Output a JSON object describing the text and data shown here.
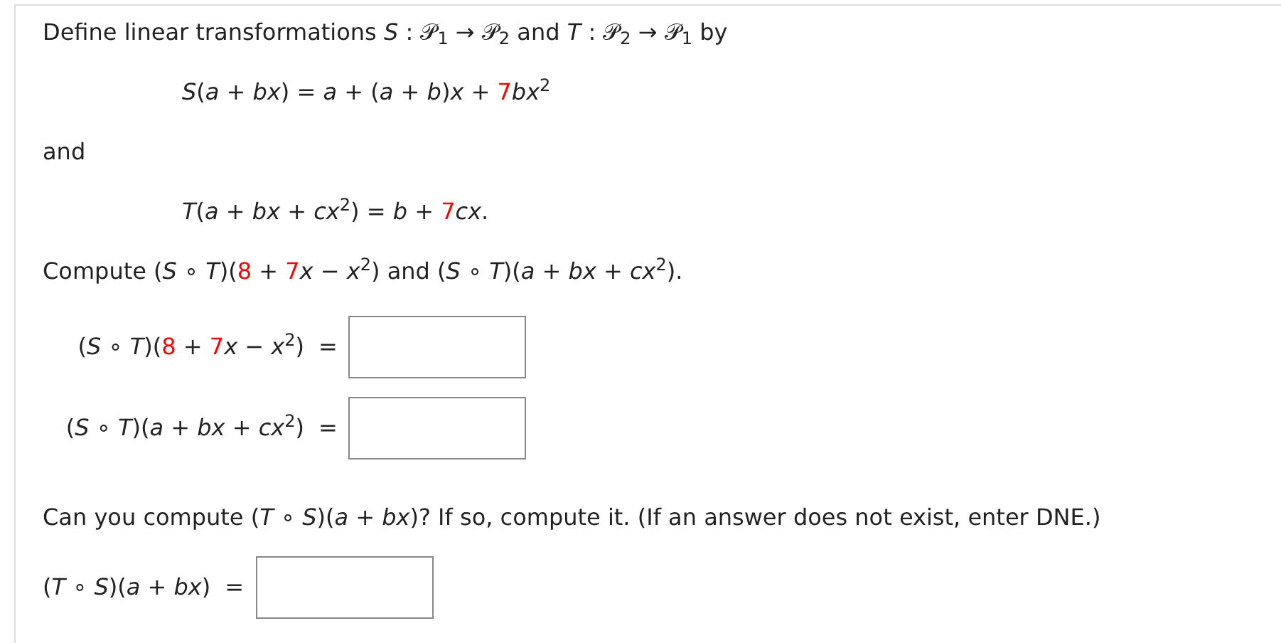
{
  "blocks": [
    {
      "kind": "paragraph",
      "segments": [
        {
          "text": "Define linear transformations *S* : 𝒫$_{1}$ → 𝒫$_{2}$ and *T* : 𝒫$_{2}$ → 𝒫$_{1}$ by",
          "highlight": false
        }
      ]
    },
    {
      "kind": "formula",
      "segments": [
        {
          "text": "*S*(*a* + *bx*) = *a* + (*a* + *b*)*x* + ",
          "highlight": false
        },
        {
          "text": "7",
          "highlight": true
        },
        {
          "text": "*bx*$^{2}$",
          "highlight": false
        }
      ]
    },
    {
      "kind": "paragraph",
      "segments": [
        {
          "text": "and",
          "highlight": false
        }
      ]
    },
    {
      "kind": "formula",
      "segments": [
        {
          "text": "*T*(*a* + *bx* + *cx*$^{2}$) = *b* + ",
          "highlight": false
        },
        {
          "text": "7",
          "highlight": true
        },
        {
          "text": "*cx*.",
          "highlight": false
        }
      ]
    },
    {
      "kind": "paragraph",
      "segments": [
        {
          "text": "Compute (*S* ∘ *T*)(",
          "highlight": false
        },
        {
          "text": "8",
          "highlight": true
        },
        {
          "text": " + ",
          "highlight": false
        },
        {
          "text": "7",
          "highlight": true
        },
        {
          "text": "*x* − *x*$^{2}$) and (*S* ∘ *T*)(*a* + *bx* + *cx*$^{2}$).",
          "highlight": false
        }
      ]
    },
    {
      "kind": "answers",
      "items": [
        {
          "label": [
            {
              "text": "(*S* ∘ *T*)(",
              "highlight": false
            },
            {
              "text": "8",
              "highlight": true
            },
            {
              "text": " + ",
              "highlight": false
            },
            {
              "text": "7",
              "highlight": true
            },
            {
              "text": "*x* − *x*$^{2}$)",
              "highlight": false
            }
          ],
          "equals": "="
        },
        {
          "label": [
            {
              "text": "(*S* ∘ *T*)(*a* + *bx* + *cx*$^{2}$)",
              "highlight": false
            }
          ],
          "equals": "="
        }
      ]
    },
    {
      "kind": "paragraph",
      "segments": [
        {
          "text": "Can you compute (*T* ∘ *S*)(*a* + *bx*)? If so, compute it. (If an answer does not exist, enter DNE.)",
          "highlight": false
        }
      ]
    },
    {
      "kind": "answer",
      "items": [
        {
          "label": [
            {
              "text": "(*T* ∘ *S*)(*a* + *bx*)",
              "highlight": false
            }
          ],
          "equals": "="
        }
      ]
    }
  ]
}
